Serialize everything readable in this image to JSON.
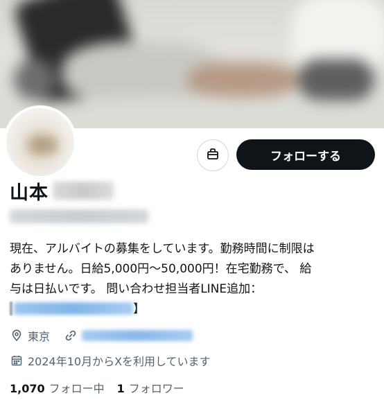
{
  "profile": {
    "name": "山本",
    "bio_lines": [
      "現在、アルバイトの募集をしています。勤務時間に制限は",
      "ありません。日給5,000円〜50,000円！在宅勤務で、 給",
      "与は日払いです。 問い合わせ担当者LINE追加："
    ],
    "bio_close_bracket": "】",
    "location": "東京",
    "joined": "2024年10月からXを利用しています"
  },
  "actions": {
    "follow_label": "フォローする"
  },
  "stats": {
    "following_count": "1,070",
    "following_label": "フォロー中",
    "followers_count": "1",
    "followers_label": "フォロワー"
  },
  "icons": {
    "gift": "gift-icon",
    "location": "location-icon",
    "link": "link-icon",
    "calendar": "calendar-icon"
  }
}
